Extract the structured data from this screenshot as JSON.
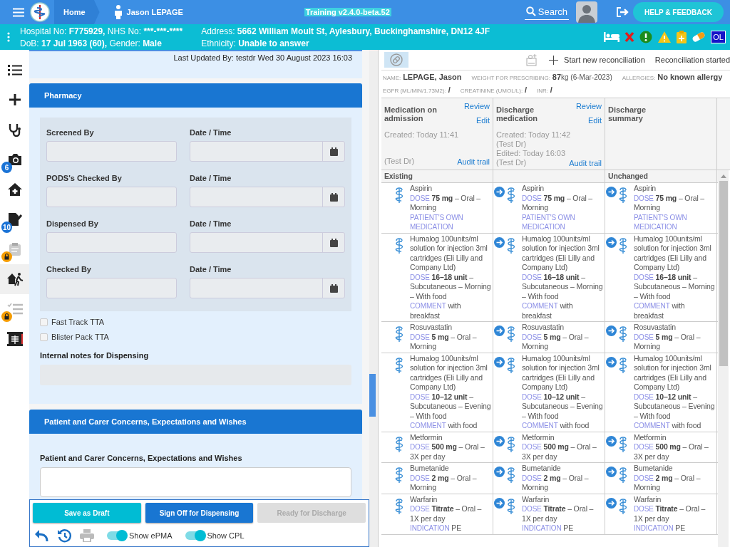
{
  "top_bar": {
    "home": "Home",
    "patient": "Jason LEPAGE",
    "environment": "Training v2.4.0-beta.52",
    "search": "Search",
    "help": "HELP & FEEDBACK"
  },
  "patient_bar": {
    "lines_left": [
      [
        {
          "label": "Hospital No:",
          "value": "F775929,"
        },
        {
          "label": "NHS No:",
          "value": "***-***-****"
        }
      ],
      [
        {
          "label": "DoB:",
          "value": "17 Jul 1963 (60),"
        },
        {
          "label": "Gender:",
          "value": "Male"
        }
      ]
    ],
    "lines_right": [
      [
        {
          "label": "Address:",
          "value": "5662 William Moult St, Aylesbury, Buckinghamshire, DN12 4JF"
        }
      ],
      [
        {
          "label": "Ethnicity:",
          "value": "Unable to answer"
        }
      ]
    ],
    "badge": "OL"
  },
  "sidebar": {
    "items": [
      {
        "selected": false,
        "locked": false
      },
      {
        "selected": false,
        "locked": false
      },
      {
        "selected": false,
        "locked": false
      },
      {
        "selected": false,
        "locked": false,
        "badge": "6"
      },
      {
        "selected": false,
        "locked": false
      },
      {
        "selected": false,
        "locked": false,
        "badge": "10"
      },
      {
        "selected": false,
        "locked": true
      },
      {
        "selected": true,
        "locked": false
      },
      {
        "selected": false,
        "locked": true
      },
      {
        "selected": false,
        "locked": false
      }
    ]
  },
  "form": {
    "last_updated": "Last Updated By: testdr Wed 30 August 2023 16:03",
    "pharmacy": {
      "title": "Pharmacy",
      "fields": [
        {
          "label": "Screened By",
          "date_label": "Date / Time"
        },
        {
          "label": "PODS's Checked By",
          "date_label": "Date / Time"
        },
        {
          "label": "Dispensed By",
          "date_label": "Date / Time"
        },
        {
          "label": "Checked By",
          "date_label": "Date / Time"
        }
      ],
      "checkboxes": [
        {
          "label": "Fast Track TTA",
          "checked": false
        },
        {
          "label": "Blister Pack TTA",
          "checked": false
        }
      ],
      "notes_label": "Internal notes for Dispensing"
    },
    "concerns": {
      "title": "Patient and Carer Concerns, Expectations and Wishes",
      "label": "Patient and Carer Concerns, Expectations and Wishes"
    },
    "buttons": [
      {
        "label": "Save as Draft",
        "kind": "draft",
        "disabled": false
      },
      {
        "label": "Sign Off for Dispensing",
        "kind": "primary",
        "disabled": false
      },
      {
        "label": "Ready for Discharge",
        "kind": "primary",
        "disabled": true
      }
    ],
    "tools": [
      {
        "disabled": false
      },
      {
        "disabled": false
      },
      {
        "disabled": true
      }
    ],
    "toggles": [
      {
        "label": "Show ePMA",
        "on": true
      },
      {
        "label": "Show CPL",
        "on": true
      }
    ]
  },
  "reconciliation": {
    "actions": [
      "Start new reconciliation",
      "Reconciliation started"
    ],
    "info": [
      [
        {
          "label": "NAME:",
          "value": "LEPAGE, Jason"
        },
        {
          "label": "WEIGHT FOR PRESCRIBING:",
          "value": "87",
          "suffix": "kg (6-Mar-2023)"
        },
        {
          "label": "ALLERGIES:",
          "value": "No known allergy"
        }
      ],
      [
        {
          "label": "EGFR (ML/MIN/1.73M2):",
          "value": "/"
        },
        {
          "label": "CREATININE (UMOL/L):",
          "value": "/"
        },
        {
          "label": "INR:",
          "value": "/"
        }
      ]
    ],
    "summaries": [
      {
        "title": "Medication on admission",
        "links": [
          "Review",
          "Edit"
        ],
        "meta": [
          "Created: Today 11:41",
          "(Test Dr)"
        ],
        "audit": "Audit trail"
      },
      {
        "title": "Discharge medication",
        "links": [
          "Review",
          "Edit"
        ],
        "meta": [
          "Created: Today 11:42",
          "(Test Dr)",
          "Edited: Today 16:03",
          "(Test Dr)"
        ],
        "audit": "Audit trail"
      },
      {
        "title": "Discharge summary"
      }
    ],
    "columns": [
      {
        "title": "Existing",
        "linked": false
      },
      {
        "linked": true
      },
      {
        "title": "Unchanged",
        "linked": true
      }
    ],
    "rows": [
      {
        "cells": [
          {
            "name": "Aspirin",
            "dose": {
              "label": "DOSE",
              "amount": "75 mg",
              "rest": "– Oral – Morning"
            },
            "notes": [
              {
                "label": "PATIENT'S OWN MEDICATION"
              }
            ]
          },
          {
            "name": "Aspirin",
            "dose": {
              "label": "DOSE",
              "amount": "75 mg",
              "rest": "– Oral – Morning"
            },
            "notes": [
              {
                "label": "PATIENT'S OWN MEDICATION"
              }
            ]
          },
          {
            "name": "Aspirin",
            "dose": {
              "label": "DOSE",
              "amount": "75 mg",
              "rest": "– Oral – Morning"
            },
            "notes": [
              {
                "label": "PATIENT'S OWN MEDICATION"
              }
            ]
          }
        ]
      },
      {
        "cells": [
          {
            "name": "Humalog 100units/ml solution for injection 3ml cartridges (Eli Lilly and Company Ltd)",
            "dose": {
              "label": "DOSE",
              "amount": "16–18 unit",
              "rest": "– Subcutaneous – Morning – With food"
            },
            "notes": [
              {
                "label": "COMMENT",
                "text": "with breakfast"
              }
            ]
          },
          {
            "name": "Humalog 100units/ml solution for injection 3ml cartridges (Eli Lilly and Company Ltd)",
            "dose": {
              "label": "DOSE",
              "amount": "16–18 unit",
              "rest": "– Subcutaneous – Morning – With food"
            },
            "notes": [
              {
                "label": "COMMENT",
                "text": "with breakfast"
              }
            ]
          },
          {
            "name": "Humalog 100units/ml solution for injection 3ml cartridges (Eli Lilly and Company Ltd)",
            "dose": {
              "label": "DOSE",
              "amount": "16–18 unit",
              "rest": "– Subcutaneous – Morning – With food"
            },
            "notes": [
              {
                "label": "COMMENT",
                "text": "with breakfast"
              }
            ]
          }
        ]
      },
      {
        "cells": [
          {
            "name": "Rosuvastatin",
            "dose": {
              "label": "DOSE",
              "amount": "5 mg",
              "rest": "– Oral – Morning"
            }
          },
          {
            "name": "Rosuvastatin",
            "dose": {
              "label": "DOSE",
              "amount": "5 mg",
              "rest": "– Oral – Morning"
            }
          },
          {
            "name": "Rosuvastatin",
            "dose": {
              "label": "DOSE",
              "amount": "5 mg",
              "rest": "– Oral – Morning"
            }
          }
        ]
      },
      {
        "cells": [
          {
            "name": "Humalog 100units/ml solution for injection 3ml cartridges (Eli Lilly and Company Ltd)",
            "dose": {
              "label": "DOSE",
              "amount": "10–12 unit",
              "rest": "– Subcutaneous – Evening – With food"
            },
            "notes": [
              {
                "label": "COMMENT",
                "text": "with food"
              }
            ]
          },
          {
            "name": "Humalog 100units/ml solution for injection 3ml cartridges (Eli Lilly and Company Ltd)",
            "dose": {
              "label": "DOSE",
              "amount": "10–12 unit",
              "rest": "– Subcutaneous – Evening – With food"
            },
            "notes": [
              {
                "label": "COMMENT",
                "text": "with food"
              }
            ]
          },
          {
            "name": "Humalog 100units/ml solution for injection 3ml cartridges (Eli Lilly and Company Ltd)",
            "dose": {
              "label": "DOSE",
              "amount": "10–12 unit",
              "rest": "– Subcutaneous – Evening – With food"
            },
            "notes": [
              {
                "label": "COMMENT",
                "text": "with food"
              }
            ]
          }
        ]
      },
      {
        "cells": [
          {
            "name": "Metformin",
            "dose": {
              "label": "DOSE",
              "amount": "500 mg",
              "rest": "– Oral – 3X per day"
            }
          },
          {
            "name": "Metformin",
            "dose": {
              "label": "DOSE",
              "amount": "500 mg",
              "rest": "– Oral – 3X per day"
            }
          },
          {
            "name": "Metformin",
            "dose": {
              "label": "DOSE",
              "amount": "500 mg",
              "rest": "– Oral – 3X per day"
            }
          }
        ]
      },
      {
        "cells": [
          {
            "name": "Bumetanide",
            "dose": {
              "label": "DOSE",
              "amount": "2 mg",
              "rest": "– Oral – Morning"
            }
          },
          {
            "name": "Bumetanide",
            "dose": {
              "label": "DOSE",
              "amount": "2 mg",
              "rest": "– Oral – Morning"
            }
          },
          {
            "name": "Bumetanide",
            "dose": {
              "label": "DOSE",
              "amount": "2 mg",
              "rest": "– Oral – Morning"
            }
          }
        ]
      },
      {
        "cells": [
          {
            "name": "Warfarin",
            "dose": {
              "label": "DOSE",
              "amount": "Titrate",
              "rest": "– Oral – 1X per day"
            },
            "notes": [
              {
                "label": "INDICATION",
                "text": "PE"
              }
            ]
          },
          {
            "name": "Warfarin",
            "dose": {
              "label": "DOSE",
              "amount": "Titrate",
              "rest": "– Oral – 1X per day"
            },
            "notes": [
              {
                "label": "INDICATION",
                "text": "PE"
              }
            ]
          },
          {
            "name": "Warfarin",
            "dose": {
              "label": "DOSE",
              "amount": "Titrate",
              "rest": "– Oral – 1X per day"
            },
            "notes": [
              {
                "label": "INDICATION",
                "text": "PE"
              }
            ]
          }
        ]
      }
    ]
  }
}
